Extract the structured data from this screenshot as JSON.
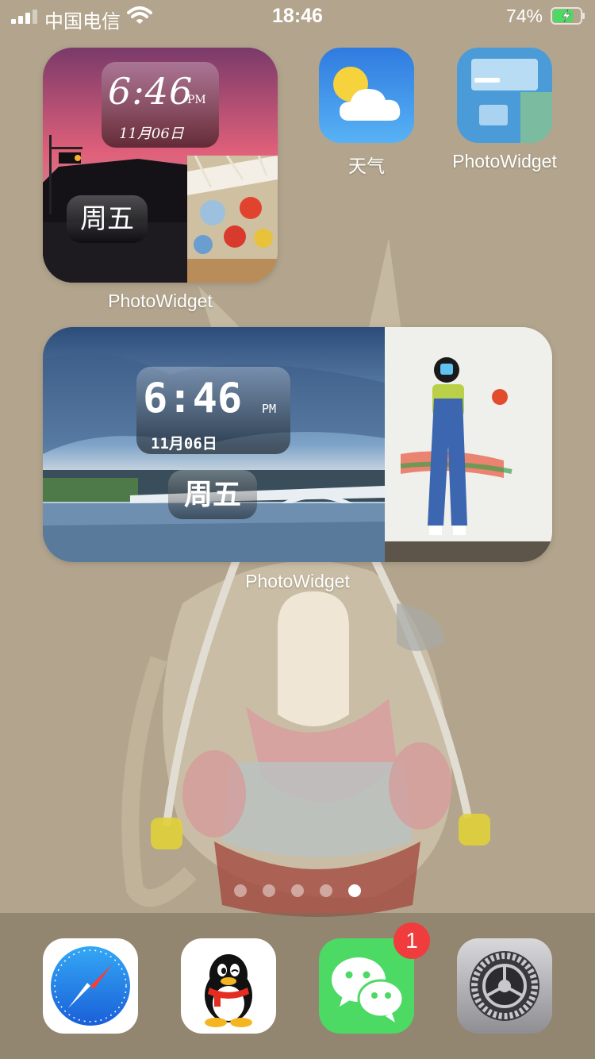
{
  "status_bar": {
    "carrier": "中国电信",
    "time": "18:46",
    "battery_percent": "74%",
    "battery_level": 0.74,
    "charging": true
  },
  "widgets": {
    "small": {
      "time": "6:46",
      "ampm": "PM",
      "date": "11月06日",
      "weekday": "周五",
      "label": "PhotoWidget"
    },
    "medium": {
      "time": "6:46",
      "ampm": "PM",
      "date": "11月06日",
      "weekday": "周五",
      "label": "PhotoWidget"
    }
  },
  "apps": [
    {
      "label": "天气",
      "icon": "weather-icon"
    },
    {
      "label": "PhotoWidget",
      "icon": "photowidget-icon"
    }
  ],
  "page_dots": {
    "count": 5,
    "active_index": 4
  },
  "dock": [
    {
      "icon": "safari-icon"
    },
    {
      "icon": "qq-icon"
    },
    {
      "icon": "wechat-icon",
      "badge": "1"
    },
    {
      "icon": "settings-icon"
    }
  ],
  "colors": {
    "wallpaper": "#b3a58d",
    "badge": "#f03c3c",
    "wechat": "#4cd964",
    "weather": "#3a8ef0"
  }
}
